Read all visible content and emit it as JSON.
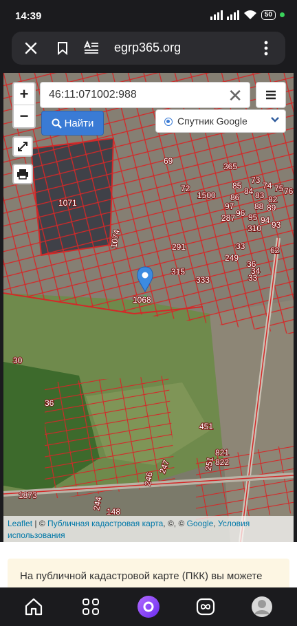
{
  "status_bar": {
    "time": "14:39",
    "battery": "50"
  },
  "browser": {
    "url": "egrp365.org"
  },
  "map": {
    "search_value": "46:11:071002:988",
    "find_button_label": "Найти",
    "layer_select_label": "Спутник Google",
    "zoom_in_label": "+",
    "zoom_out_label": "−",
    "marker_parcel_label": "1068",
    "parcel_labels": [
      "1071",
      "69",
      "365",
      "73",
      "74",
      "75",
      "76",
      "72",
      "1500",
      "85",
      "84",
      "83",
      "82",
      "88",
      "89",
      "86",
      "97",
      "96",
      "95",
      "94",
      "287",
      "310",
      "93",
      "1074",
      "291",
      "33",
      "249",
      "62",
      "315",
      "333",
      "36",
      "34",
      "33",
      "30",
      "36",
      "451",
      "247",
      "821",
      "822",
      "246",
      "251",
      "1873",
      "244",
      "148",
      "140",
      "139",
      "270"
    ],
    "attribution": {
      "leaflet": "Leaflet",
      "sep1": " | © ",
      "pkk": "Публичная кадастровая карта",
      "sep2": ", ©, © ",
      "google": "Google",
      "terms": "Условия использования"
    }
  },
  "notice_text": "На публичной кадастровой карте (ПКК) вы можете",
  "icons": [
    "close-icon",
    "bookmark-icon",
    "reader-mode-icon",
    "more-vert-icon",
    "home-icon",
    "apps-icon",
    "alice-icon",
    "tabs-icon",
    "profile-icon",
    "expand-icon",
    "print-icon",
    "search-icon",
    "hamburger-icon",
    "chevron-down-icon",
    "map-marker-icon"
  ]
}
